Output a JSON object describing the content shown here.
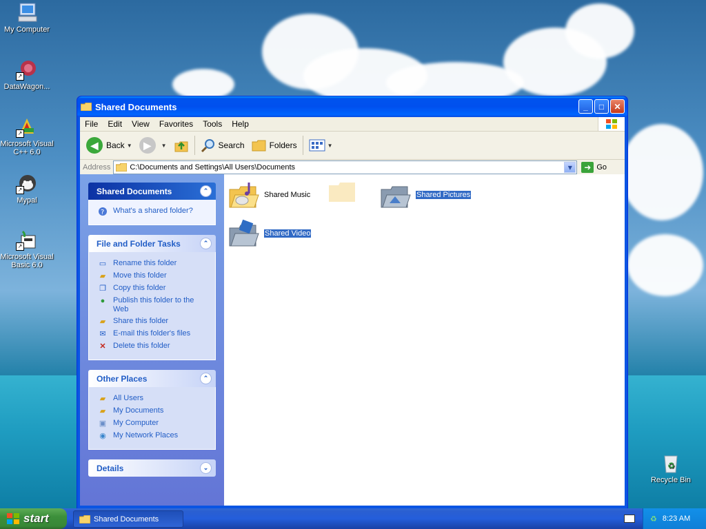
{
  "desktop": {
    "icons": [
      {
        "label": "My Computer"
      },
      {
        "label": "DataWagon..."
      },
      {
        "label": "Microsoft Visual C++ 6.0"
      },
      {
        "label": "Mypal"
      },
      {
        "label": "Microsoft Visual Basic 6.0"
      },
      {
        "label": "Recycle Bin"
      }
    ]
  },
  "window": {
    "title": "Shared Documents",
    "menu": [
      "File",
      "Edit",
      "View",
      "Favorites",
      "Tools",
      "Help"
    ],
    "toolbar": {
      "back": "Back",
      "search": "Search",
      "folders": "Folders"
    },
    "address": {
      "label": "Address",
      "value": "C:\\Documents and Settings\\All Users\\Documents",
      "go": "Go"
    },
    "panels": {
      "shared": {
        "title": "Shared Documents",
        "links": [
          "What's a shared folder?"
        ]
      },
      "tasks": {
        "title": "File and Folder Tasks",
        "links": [
          "Rename this folder",
          "Move this folder",
          "Copy this folder",
          "Publish this folder to the Web",
          "Share this folder",
          "E-mail this folder's files",
          "Delete this folder"
        ]
      },
      "places": {
        "title": "Other Places",
        "links": [
          "All Users",
          "My Documents",
          "My Computer",
          "My Network Places"
        ]
      },
      "details": {
        "title": "Details"
      }
    },
    "items": [
      {
        "label": "Shared Music",
        "selected": false
      },
      {
        "label": "Shared Pictures",
        "selected": true
      },
      {
        "label": "Shared Video",
        "selected": true
      }
    ]
  },
  "taskbar": {
    "start": "start",
    "task": "Shared Documents",
    "clock": "8:23 AM"
  }
}
